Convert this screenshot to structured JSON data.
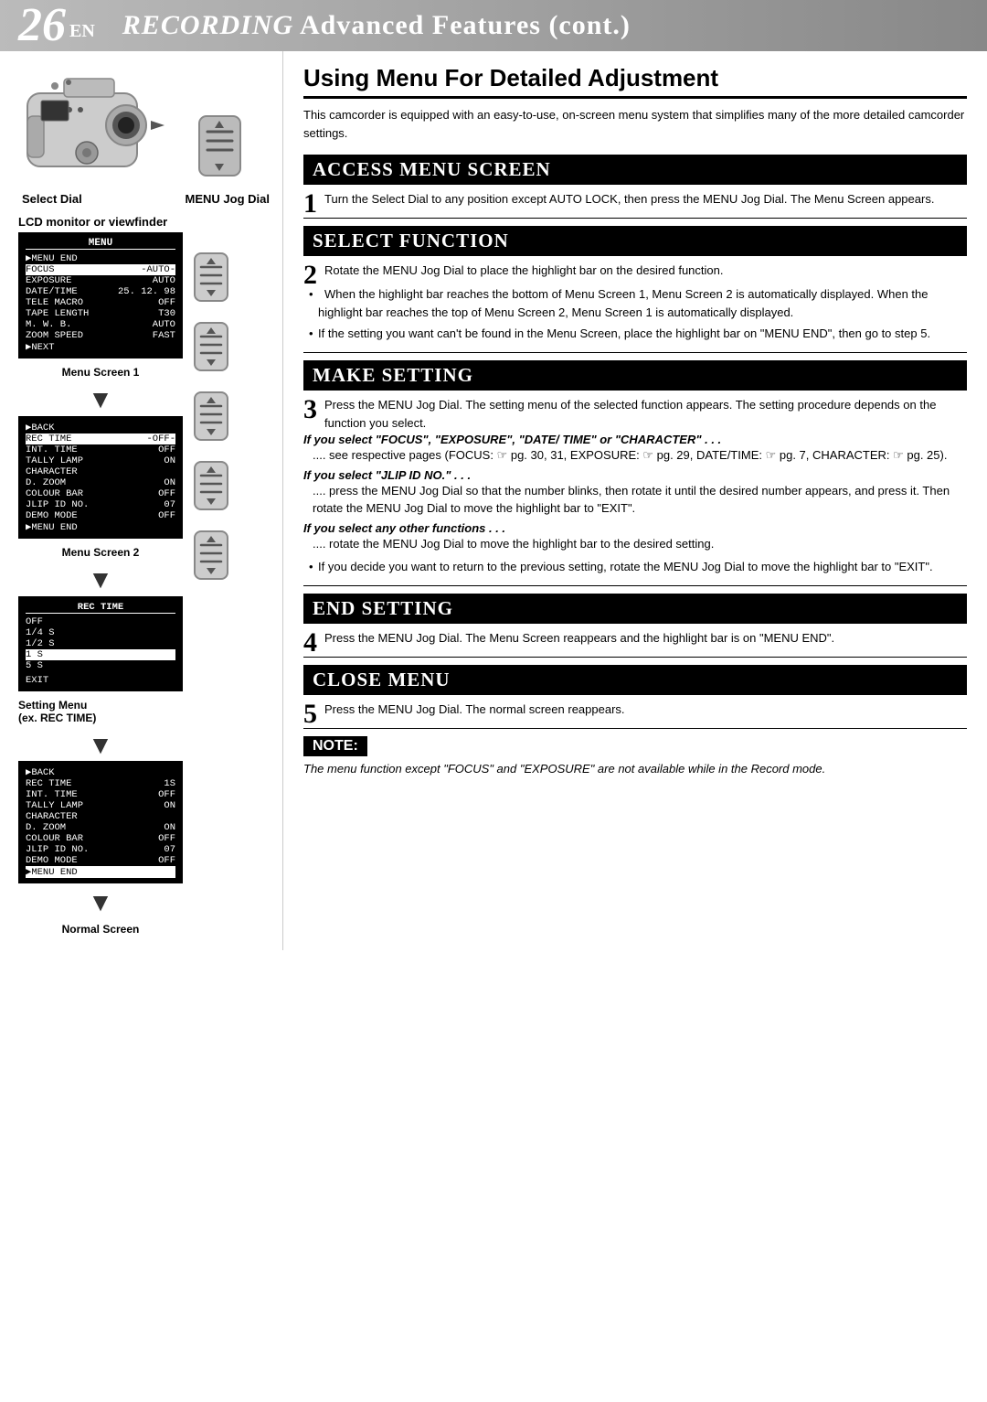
{
  "header": {
    "page_number": "26",
    "page_lang": "EN",
    "title_italic": "RECORDING",
    "title_normal": " Advanced Features (cont.)"
  },
  "left": {
    "select_dial_label": "Select Dial",
    "menu_jog_dial_label": "MENU Jog Dial",
    "lcd_label": "LCD monitor or viewfinder",
    "menu_screen_1_title": "MENU",
    "menu_screen_1_label": "Menu Screen 1",
    "menu_screen_1_rows": [
      {
        "left": "▶MENU END",
        "right": "",
        "highlight": false
      },
      {
        "left": "FOCUS",
        "right": "AUTO",
        "highlight": true
      },
      {
        "left": "EXPOSURE",
        "right": "AUTO",
        "highlight": false
      },
      {
        "left": "DATE/TIME",
        "right": "25. 12. 98",
        "highlight": false
      },
      {
        "left": "TELE MACRO",
        "right": "OFF",
        "highlight": false
      },
      {
        "left": "TAPE LENGTH",
        "right": "T30",
        "highlight": false
      },
      {
        "left": "M. W. B.",
        "right": "AUTO",
        "highlight": false
      },
      {
        "left": "ZOOM SPEED",
        "right": "FAST",
        "highlight": false
      },
      {
        "left": "▶NEXT",
        "right": "",
        "highlight": false
      }
    ],
    "menu_screen_2_title": "",
    "menu_screen_2_label": "Menu Screen 2",
    "menu_screen_2_rows": [
      {
        "left": "▶BACK",
        "right": "",
        "highlight": false
      },
      {
        "left": "REC TIME",
        "right": "OFF",
        "highlight": true
      },
      {
        "left": "INT. TIME",
        "right": "OFF",
        "highlight": false
      },
      {
        "left": "TALLY LAMP",
        "right": "ON",
        "highlight": false
      },
      {
        "left": "CHARACTER",
        "right": "",
        "highlight": false
      },
      {
        "left": "D. ZOOM",
        "right": "ON",
        "highlight": false
      },
      {
        "left": "COLOUR BAR",
        "right": "OFF",
        "highlight": false
      },
      {
        "left": "JLIP ID NO.",
        "right": "07",
        "highlight": false
      },
      {
        "left": "DEMO MODE",
        "right": "OFF",
        "highlight": false
      },
      {
        "left": "▶MENU END",
        "right": "",
        "highlight": false
      }
    ],
    "setting_menu_title": "REC TIME",
    "setting_menu_label_1": "Setting Menu",
    "setting_menu_label_2": "(ex. REC TIME)",
    "setting_menu_rows": [
      {
        "val": "OFF",
        "highlight": false
      },
      {
        "val": "1/4 S",
        "highlight": false
      },
      {
        "val": "1/2 S",
        "highlight": false
      },
      {
        "val": "1 S",
        "highlight": true
      },
      {
        "val": "5 S",
        "highlight": false
      }
    ],
    "setting_menu_exit": "EXIT",
    "menu_screen_3_label": "",
    "menu_screen_3_rows": [
      {
        "left": "▶BACK",
        "right": "",
        "highlight": false
      },
      {
        "left": "REC TIME",
        "right": "1S",
        "highlight": false
      },
      {
        "left": "INT. TIME",
        "right": "OFF",
        "highlight": false
      },
      {
        "left": "TALLY LAMP",
        "right": "ON",
        "highlight": false
      },
      {
        "left": "CHARACTER",
        "right": "",
        "highlight": false
      },
      {
        "left": "D. ZOOM",
        "right": "ON",
        "highlight": false
      },
      {
        "left": "COLOUR BAR",
        "right": "OFF",
        "highlight": false
      },
      {
        "left": "JLIP ID NO.",
        "right": "07",
        "highlight": false
      },
      {
        "left": "DEMO MODE",
        "right": "OFF",
        "highlight": false
      },
      {
        "left": "▶MENU END",
        "right": "",
        "highlight": true
      }
    ],
    "normal_screen_label": "Normal Screen"
  },
  "right": {
    "section_main_title": "Using Menu For Detailed Adjustment",
    "intro": "This camcorder is equipped with an easy-to-use, on-screen menu system that simplifies many of the more detailed camcorder settings.",
    "sections": [
      {
        "id": "access",
        "header": "ACCESS MENU SCREEN",
        "step": "1",
        "text": "Turn the Select Dial to any position except AUTO LOCK, then press the MENU Jog Dial. The Menu Screen appears."
      },
      {
        "id": "select",
        "header": "SELECT FUNCTION",
        "step": "2",
        "text": "Rotate the MENU Jog Dial to place the highlight bar on the desired function."
      }
    ],
    "select_bullets": [
      "When the highlight bar reaches the bottom of Menu Screen 1, Menu Screen 2 is automatically displayed. When the highlight bar reaches the top of Menu Screen 2, Menu Screen 1 is automatically displayed.",
      "If the setting you want can't be found in the Menu Screen, place the highlight bar on \"MENU END\", then go to step 5."
    ],
    "make_setting": {
      "header": "MAKE SETTING",
      "step": "3",
      "text": "Press the MENU Jog Dial. The setting menu of the selected function appears. The setting procedure depends on the function you select.",
      "sub1_bold": "If you select \"FOCUS\", \"EXPOSURE\", \"DATE/ TIME\" or \"CHARACTER\" . . .",
      "sub1_text": ".... see respective pages (FOCUS: ☞ pg. 30, 31, EXPOSURE: ☞ pg. 29, DATE/TIME: ☞ pg. 7, CHARACTER: ☞ pg. 25).",
      "sub2_bold": "If you select \"JLIP ID NO.\" . . .",
      "sub2_text": ".... press the MENU Jog Dial so that the number blinks, then rotate it until the desired number appears, and press it. Then rotate the MENU Jog Dial to move the highlight bar to \"EXIT\".",
      "sub3_bold": "If you select any other functions . . .",
      "sub3_text": ".... rotate the MENU Jog Dial to move the highlight bar to the desired setting.",
      "sub3_bullet": "If you decide you want to return to the previous setting, rotate the MENU Jog Dial to move the highlight bar to \"EXIT\"."
    },
    "end_setting": {
      "header": "END SETTING",
      "step": "4",
      "text": "Press the MENU Jog Dial. The Menu Screen reappears and the highlight bar is on \"MENU END\"."
    },
    "close_menu": {
      "header": "CLOSE MENU",
      "step": "5",
      "text": "Press the MENU Jog Dial. The normal screen reappears."
    },
    "note": {
      "label": "NOTE:",
      "text": "The menu function except \"FOCUS\" and \"EXPOSURE\" are not available while in the Record mode."
    }
  }
}
